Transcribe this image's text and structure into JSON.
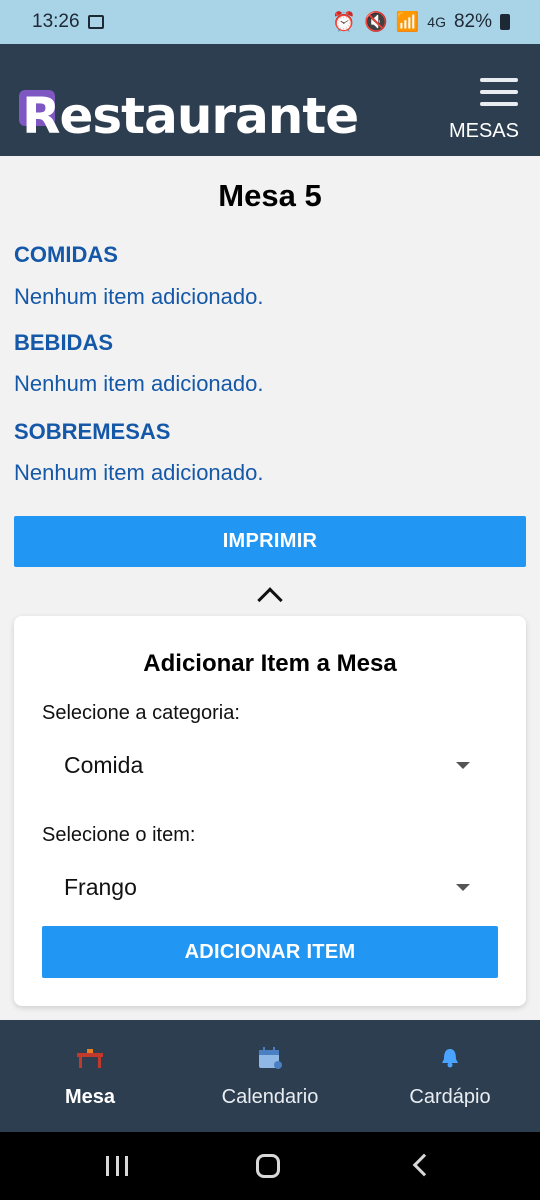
{
  "status_bar": {
    "time": "13:26",
    "battery": "82%",
    "network_label": "4G"
  },
  "header": {
    "brand": "Restaurante",
    "nav_link": "MESAS",
    "menu_icon": "hamburger-icon"
  },
  "page": {
    "title": "Mesa 5",
    "sections": [
      {
        "title": "COMIDAS",
        "empty_text": "Nenhum item adicionado."
      },
      {
        "title": "BEBIDAS",
        "empty_text": "Nenhum item adicionado."
      },
      {
        "title": "SOBREMESAS",
        "empty_text": "Nenhum item adicionado."
      }
    ],
    "print_button": "IMPRIMIR"
  },
  "add_item_panel": {
    "title": "Adicionar Item a Mesa",
    "category_label": "Selecione a categoria:",
    "category_value": "Comida",
    "item_label": "Selecione o item:",
    "item_value": "Frango",
    "add_button": "ADICIONAR ITEM"
  },
  "bottom_nav": {
    "items": [
      {
        "label": "Mesa",
        "icon": "table-icon",
        "active": true
      },
      {
        "label": "Calendario",
        "icon": "calendar-icon",
        "active": false
      },
      {
        "label": "Cardápio",
        "icon": "bell-icon",
        "active": false
      }
    ]
  },
  "colors": {
    "header_bg": "#2d3e50",
    "accent": "#2196f3",
    "section_text": "#1558a8",
    "logo_accent": "#7e57c2"
  }
}
